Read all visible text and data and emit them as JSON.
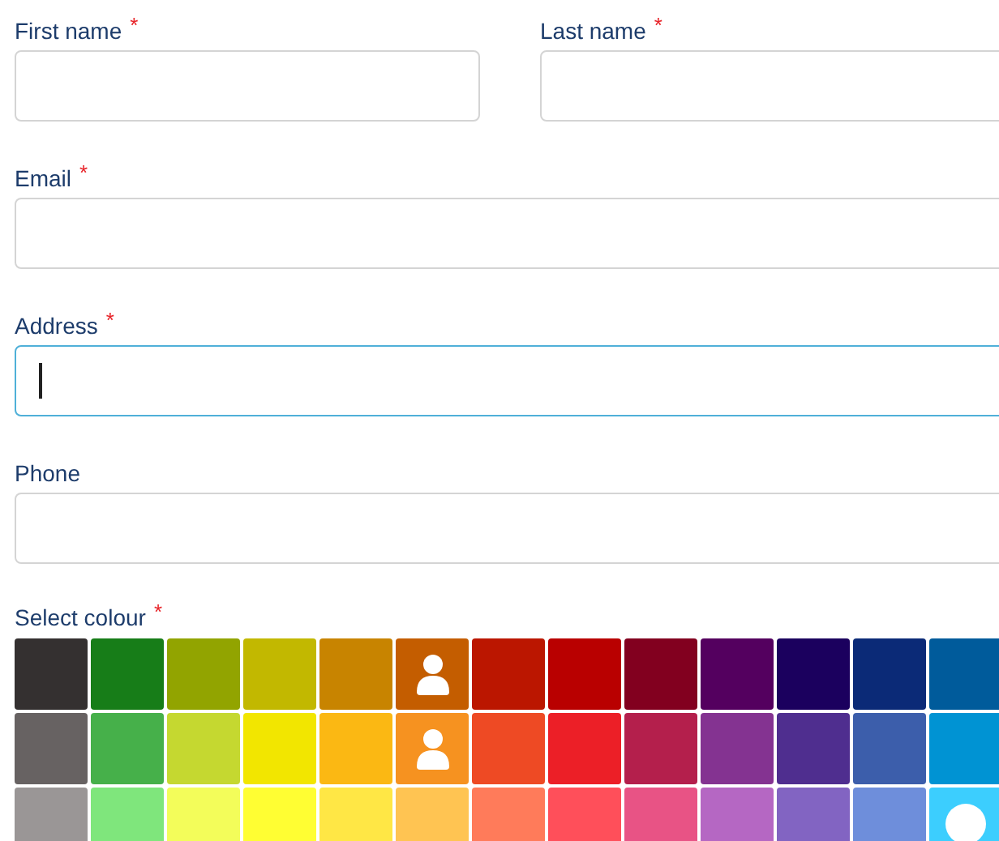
{
  "field_rows": [
    [
      {
        "label": "First name",
        "required_mark": "*",
        "focused": false
      },
      {
        "label": "Last name",
        "required_mark": "*",
        "focused": false
      }
    ],
    [
      {
        "label": "Email",
        "required_mark": "*",
        "focused": false
      }
    ],
    [
      {
        "label": "Address",
        "required_mark": "*",
        "focused": true
      }
    ],
    [
      {
        "label": "Phone",
        "focused": false
      }
    ]
  ],
  "colour_picker": {
    "label": "Select colour",
    "required_mark": "*",
    "swatches": [
      [
        {
          "color": "#343030",
          "taken": false,
          "selected": false
        },
        {
          "color": "#177d18",
          "taken": false,
          "selected": false
        },
        {
          "color": "#92a400",
          "taken": false,
          "selected": false
        },
        {
          "color": "#c2b800",
          "taken": false,
          "selected": false
        },
        {
          "color": "#c88400",
          "taken": false,
          "selected": false
        },
        {
          "color": "#c45d00",
          "taken": true,
          "selected": false
        },
        {
          "color": "#bb1600",
          "taken": false,
          "selected": false
        },
        {
          "color": "#b90000",
          "taken": false,
          "selected": false
        },
        {
          "color": "#82001f",
          "taken": false,
          "selected": false
        },
        {
          "color": "#54005f",
          "taken": false,
          "selected": false
        },
        {
          "color": "#1b005e",
          "taken": false,
          "selected": false
        },
        {
          "color": "#0b2a77",
          "taken": false,
          "selected": false
        },
        {
          "color": "#005b9b",
          "taken": false,
          "selected": false
        }
      ],
      [
        {
          "color": "#676262",
          "taken": false,
          "selected": false
        },
        {
          "color": "#46b04a",
          "taken": false,
          "selected": false
        },
        {
          "color": "#c5d830",
          "taken": false,
          "selected": false
        },
        {
          "color": "#f2e600",
          "taken": false,
          "selected": false
        },
        {
          "color": "#fbb813",
          "taken": false,
          "selected": false
        },
        {
          "color": "#f69220",
          "taken": true,
          "selected": false
        },
        {
          "color": "#ee4a24",
          "taken": false,
          "selected": false
        },
        {
          "color": "#ec1f27",
          "taken": false,
          "selected": false
        },
        {
          "color": "#b41f4c",
          "taken": false,
          "selected": false
        },
        {
          "color": "#843391",
          "taken": false,
          "selected": false
        },
        {
          "color": "#4f2e8f",
          "taken": false,
          "selected": false
        },
        {
          "color": "#3c5eab",
          "taken": false,
          "selected": false
        },
        {
          "color": "#0093d3",
          "taken": false,
          "selected": false
        }
      ],
      [
        {
          "color": "#9a9696",
          "taken": false,
          "selected": false
        },
        {
          "color": "#7fe67c",
          "taken": false,
          "selected": false
        },
        {
          "color": "#f3fd5a",
          "taken": false,
          "selected": false
        },
        {
          "color": "#fffe33",
          "taken": false,
          "selected": false
        },
        {
          "color": "#ffe745",
          "taken": false,
          "selected": false
        },
        {
          "color": "#ffc452",
          "taken": false,
          "selected": false
        },
        {
          "color": "#ff7b5a",
          "taken": false,
          "selected": false
        },
        {
          "color": "#ff4f5a",
          "taken": false,
          "selected": false
        },
        {
          "color": "#e85385",
          "taken": false,
          "selected": false
        },
        {
          "color": "#b567c3",
          "taken": false,
          "selected": false
        },
        {
          "color": "#8264c2",
          "taken": false,
          "selected": false
        },
        {
          "color": "#6e8edb",
          "taken": false,
          "selected": false
        },
        {
          "color": "#3ccefe",
          "taken": false,
          "selected": true
        }
      ]
    ]
  }
}
